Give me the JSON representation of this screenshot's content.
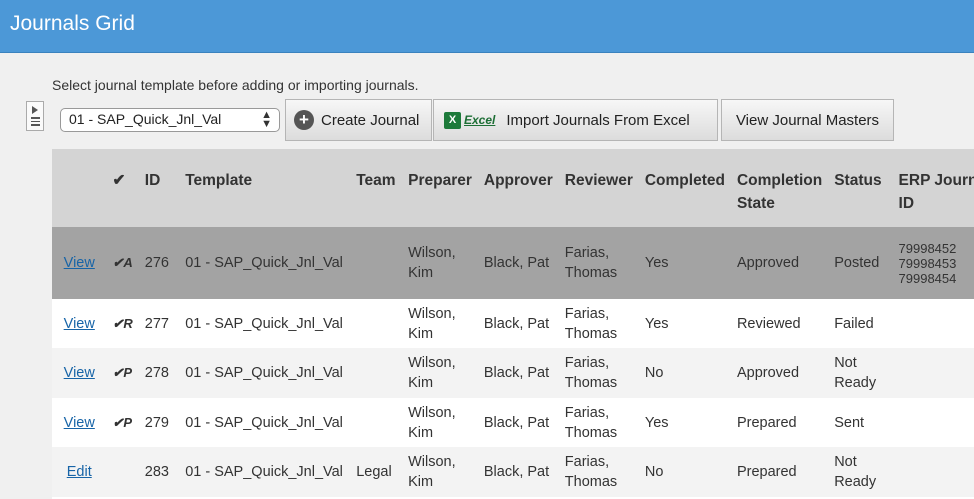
{
  "window": {
    "title": "Journals Grid"
  },
  "hint": "Select journal template before adding or importing journals.",
  "toolbar": {
    "template_select": {
      "value": "01 - SAP_Quick_Jnl_Val"
    },
    "create_label": "Create Journal",
    "excel_label": "Excel",
    "import_label": "Import Journals From Excel",
    "masters_label": "View Journal Masters"
  },
  "grid": {
    "columns": [
      "",
      "✔",
      "ID",
      "Template",
      "Team",
      "Preparer",
      "Approver",
      "Reviewer",
      "Completed",
      "Completion State",
      "Status",
      "ERP Journal ID"
    ],
    "rows": [
      {
        "action": "View",
        "check": "✔A",
        "id": "276",
        "template": "01 - SAP_Quick_Jnl_Val",
        "team": "",
        "preparer": "Wilson, Kim",
        "approver": "Black, Pat",
        "reviewer": "Farias, Thomas",
        "completed": "Yes",
        "completion_state": "Approved",
        "status": "Posted",
        "erp": [
          "79998452",
          "79998453",
          "79998454"
        ]
      },
      {
        "action": "View",
        "check": "✔R",
        "id": "277",
        "template": "01 - SAP_Quick_Jnl_Val",
        "team": "",
        "preparer": "Wilson, Kim",
        "approver": "Black, Pat",
        "reviewer": "Farias, Thomas",
        "completed": "Yes",
        "completion_state": "Reviewed",
        "status": "Failed",
        "erp": []
      },
      {
        "action": "View",
        "check": "✔P",
        "id": "278",
        "template": "01 - SAP_Quick_Jnl_Val",
        "team": "",
        "preparer": "Wilson, Kim",
        "approver": "Black, Pat",
        "reviewer": "Farias, Thomas",
        "completed": "No",
        "completion_state": "Approved",
        "status": "Not Ready",
        "erp": []
      },
      {
        "action": "View",
        "check": "✔P",
        "id": "279",
        "template": "01 - SAP_Quick_Jnl_Val",
        "team": "",
        "preparer": "Wilson, Kim",
        "approver": "Black, Pat",
        "reviewer": "Farias, Thomas",
        "completed": "Yes",
        "completion_state": "Prepared",
        "status": "Sent",
        "erp": []
      },
      {
        "action": "Edit",
        "check": "",
        "id": "283",
        "template": "01 - SAP_Quick_Jnl_Val",
        "team": "Legal",
        "preparer": "Wilson, Kim",
        "approver": "Black, Pat",
        "reviewer": "Farias, Thomas",
        "completed": "No",
        "completion_state": "Prepared",
        "status": "Not Ready",
        "erp": []
      }
    ]
  }
}
